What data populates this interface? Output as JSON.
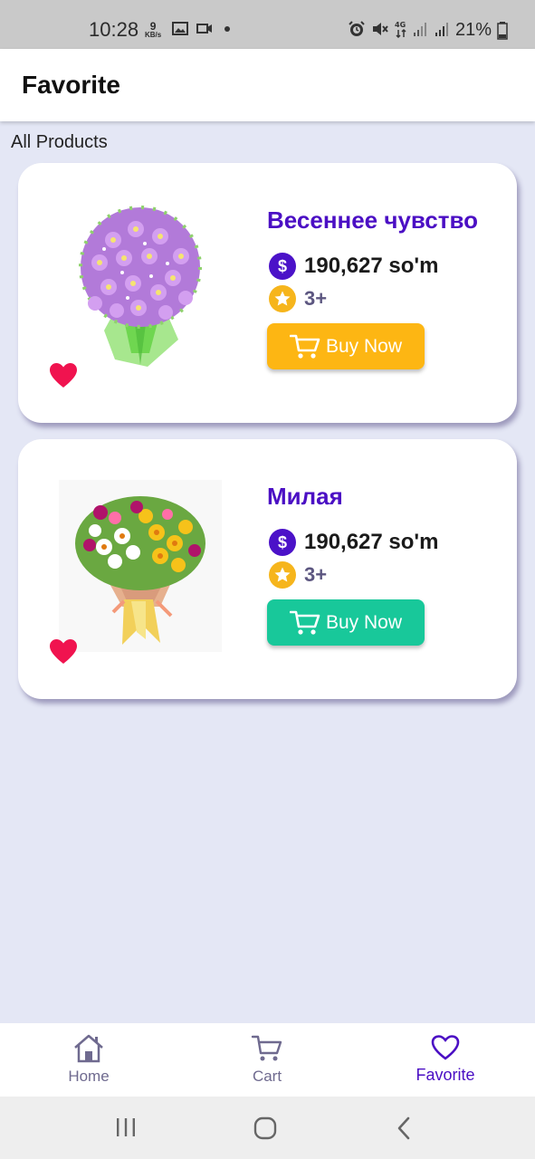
{
  "status_bar": {
    "time": "10:28",
    "speed_value": "9",
    "speed_unit": "KB/s",
    "battery": "21%",
    "icons": [
      "gallery-icon",
      "video-icon",
      "dot-icon",
      "alarm-icon",
      "mute-icon",
      "4g-icon",
      "signal-icon",
      "signal-icon",
      "battery-icon"
    ]
  },
  "app_bar": {
    "title": "Favorite"
  },
  "section": {
    "label": "All Products"
  },
  "products": [
    {
      "name": "Весеннее чувство",
      "price": "190,627 so'm",
      "rating": "3+",
      "buy_label": "Buy Now",
      "button_color": "#fdb613",
      "favorite": true
    },
    {
      "name": "Милая",
      "price": "190,627 so'm",
      "rating": "3+",
      "buy_label": "Buy Now",
      "button_color": "#18c89a",
      "favorite": true
    }
  ],
  "bottom_nav": {
    "items": [
      {
        "label": "Home",
        "icon": "home-icon",
        "active": false
      },
      {
        "label": "Cart",
        "icon": "cart-icon",
        "active": false
      },
      {
        "label": "Favorite",
        "icon": "heart-outline-icon",
        "active": true
      }
    ]
  },
  "colors": {
    "accent": "#4b0fc4",
    "background": "#e4e7f5",
    "heart": "#f0134f",
    "star": "#f6b51c"
  }
}
